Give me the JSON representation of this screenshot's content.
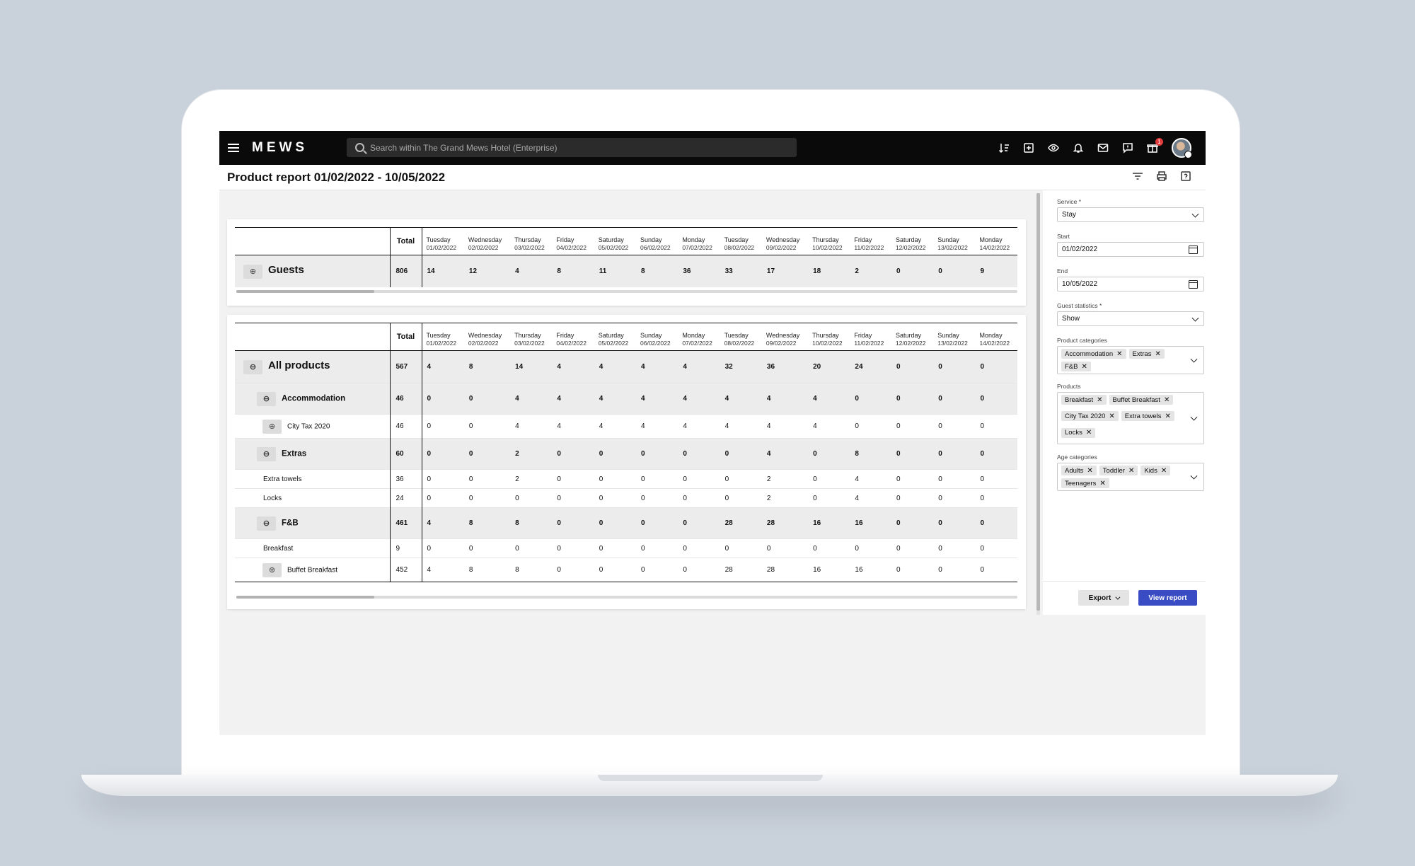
{
  "app": {
    "logo": "MEWS",
    "search_placeholder": "Search within The Grand Mews Hotel (Enterprise)",
    "notification_count": "1"
  },
  "page": {
    "title": "Product report 01/02/2022 - 10/05/2022"
  },
  "columns": [
    {
      "day": "Tuesday",
      "date": "01/02/2022"
    },
    {
      "day": "Wednesday",
      "date": "02/02/2022"
    },
    {
      "day": "Thursday",
      "date": "03/02/2022"
    },
    {
      "day": "Friday",
      "date": "04/02/2022"
    },
    {
      "day": "Saturday",
      "date": "05/02/2022"
    },
    {
      "day": "Sunday",
      "date": "06/02/2022"
    },
    {
      "day": "Monday",
      "date": "07/02/2022"
    },
    {
      "day": "Tuesday",
      "date": "08/02/2022"
    },
    {
      "day": "Wednesday",
      "date": "09/02/2022"
    },
    {
      "day": "Thursday",
      "date": "10/02/2022"
    },
    {
      "day": "Friday",
      "date": "11/02/2022"
    },
    {
      "day": "Saturday",
      "date": "12/02/2022"
    },
    {
      "day": "Sunday",
      "date": "13/02/2022"
    },
    {
      "day": "Monday",
      "date": "14/02/2022"
    }
  ],
  "total_label": "Total",
  "guests": {
    "label": "Guests",
    "total": "806",
    "values": [
      "14",
      "12",
      "4",
      "8",
      "11",
      "8",
      "36",
      "33",
      "17",
      "18",
      "2",
      "0",
      "0",
      "9"
    ]
  },
  "products": [
    {
      "label": "All products",
      "level": "top",
      "toggle": "⊖",
      "total": "567",
      "values": [
        "4",
        "8",
        "14",
        "4",
        "4",
        "4",
        "4",
        "32",
        "36",
        "20",
        "24",
        "0",
        "0",
        "0"
      ]
    },
    {
      "label": "Accommodation",
      "level": "cat",
      "toggle": "⊖",
      "total": "46",
      "values": [
        "0",
        "0",
        "4",
        "4",
        "4",
        "4",
        "4",
        "4",
        "4",
        "4",
        "0",
        "0",
        "0",
        "0"
      ]
    },
    {
      "label": "City Tax 2020",
      "level": "sub",
      "toggle": "⊕",
      "total": "46",
      "values": [
        "0",
        "0",
        "4",
        "4",
        "4",
        "4",
        "4",
        "4",
        "4",
        "4",
        "0",
        "0",
        "0",
        "0"
      ]
    },
    {
      "label": "Extras",
      "level": "cat",
      "toggle": "⊖",
      "total": "60",
      "values": [
        "0",
        "0",
        "2",
        "0",
        "0",
        "0",
        "0",
        "0",
        "4",
        "0",
        "8",
        "0",
        "0",
        "0"
      ]
    },
    {
      "label": "Extra towels",
      "level": "item",
      "toggle": "",
      "total": "36",
      "values": [
        "0",
        "0",
        "2",
        "0",
        "0",
        "0",
        "0",
        "0",
        "2",
        "0",
        "4",
        "0",
        "0",
        "0"
      ]
    },
    {
      "label": "Locks",
      "level": "item",
      "toggle": "",
      "total": "24",
      "values": [
        "0",
        "0",
        "0",
        "0",
        "0",
        "0",
        "0",
        "0",
        "2",
        "0",
        "4",
        "0",
        "0",
        "0"
      ]
    },
    {
      "label": "F&B",
      "level": "cat",
      "toggle": "⊖",
      "total": "461",
      "values": [
        "4",
        "8",
        "8",
        "0",
        "0",
        "0",
        "0",
        "28",
        "28",
        "16",
        "16",
        "0",
        "0",
        "0"
      ]
    },
    {
      "label": "Breakfast",
      "level": "item",
      "toggle": "",
      "total": "9",
      "values": [
        "0",
        "0",
        "0",
        "0",
        "0",
        "0",
        "0",
        "0",
        "0",
        "0",
        "0",
        "0",
        "0",
        "0"
      ]
    },
    {
      "label": "Buffet Breakfast",
      "level": "sub",
      "toggle": "⊕",
      "total": "452",
      "values": [
        "4",
        "8",
        "8",
        "0",
        "0",
        "0",
        "0",
        "28",
        "28",
        "16",
        "16",
        "0",
        "0",
        "0"
      ]
    }
  ],
  "filters": {
    "service_label": "Service *",
    "service_value": "Stay",
    "start_label": "Start",
    "start_value": "01/02/2022",
    "end_label": "End",
    "end_value": "10/05/2022",
    "guest_stats_label": "Guest statistics *",
    "guest_stats_value": "Show",
    "product_categories_label": "Product categories",
    "product_categories": [
      "Accommodation",
      "Extras",
      "F&B"
    ],
    "products_label": "Products",
    "products": [
      "Breakfast",
      "Buffet Breakfast",
      "City Tax 2020",
      "Extra towels",
      "Locks"
    ],
    "age_categories_label": "Age categories",
    "age_categories": [
      "Adults",
      "Toddler",
      "Kids",
      "Teenagers"
    ],
    "export_label": "Export",
    "view_report_label": "View report"
  },
  "colors": {
    "topbar": "#0a0a0a",
    "primary_button": "#3a4cc4",
    "badge": "#e23b3b"
  }
}
